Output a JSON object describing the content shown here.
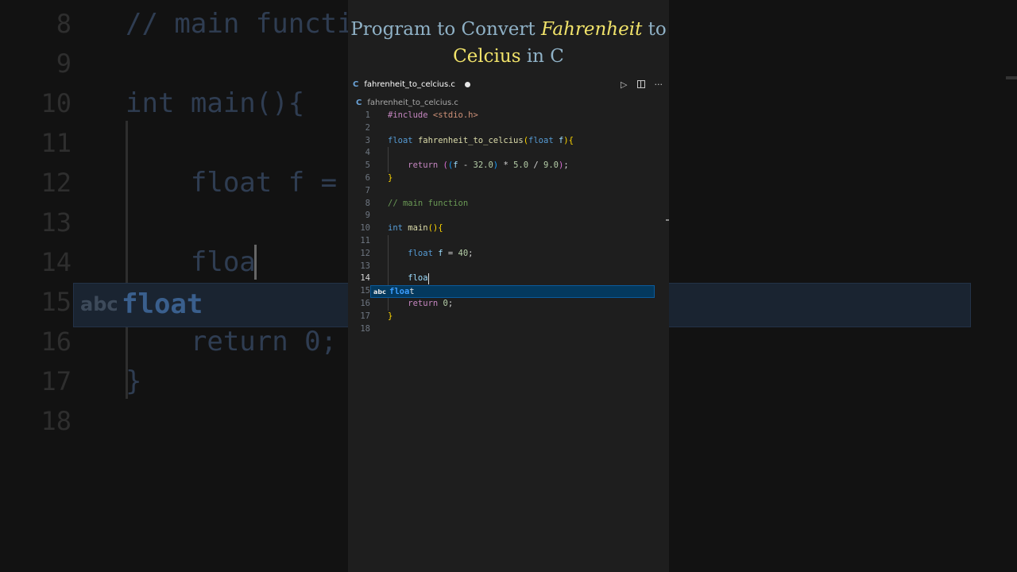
{
  "title": {
    "part1": "Program to Convert ",
    "highlight1": "Fahrenheit",
    "part2": " to",
    "highlight2": "Celcius",
    "part3": " in C"
  },
  "tab": {
    "icon": "C",
    "filename": "fahrenheit_to_celcius.c"
  },
  "breadcrumb": {
    "icon": "C",
    "filename": "fahrenheit_to_celcius.c"
  },
  "editor": {
    "active_line": 14,
    "lines": [
      {
        "n": "1",
        "segs": [
          [
            "pp",
            "#include "
          ],
          [
            "str",
            "<stdio.h>"
          ]
        ]
      },
      {
        "n": "2",
        "segs": []
      },
      {
        "n": "3",
        "segs": [
          [
            "kw",
            "float "
          ],
          [
            "fn",
            "fahrenheit_to_celcius"
          ],
          [
            "br1",
            "("
          ],
          [
            "kw",
            "float "
          ],
          [
            "id",
            "f"
          ],
          [
            "br1",
            ")"
          ],
          [
            "br1",
            "{"
          ]
        ]
      },
      {
        "n": "4",
        "segs": []
      },
      {
        "n": "5",
        "segs": [
          [
            "pp",
            "    return "
          ],
          [
            "br2",
            "("
          ],
          [
            "br3",
            "("
          ],
          [
            "id",
            "f"
          ],
          [
            "",
            " - "
          ],
          [
            "nm",
            "32.0"
          ],
          [
            "br3",
            ")"
          ],
          [
            "",
            " * "
          ],
          [
            "nm",
            "5.0"
          ],
          [
            "",
            " / "
          ],
          [
            "nm",
            "9.0"
          ],
          [
            "br2",
            ")"
          ],
          [
            "",
            ";"
          ]
        ]
      },
      {
        "n": "6",
        "segs": [
          [
            "br1",
            "}"
          ]
        ]
      },
      {
        "n": "7",
        "segs": []
      },
      {
        "n": "8",
        "segs": [
          [
            "cm",
            "// main function"
          ]
        ]
      },
      {
        "n": "9",
        "segs": []
      },
      {
        "n": "10",
        "segs": [
          [
            "kw",
            "int "
          ],
          [
            "fn",
            "main"
          ],
          [
            "br1",
            "()"
          ],
          [
            "br1",
            "{"
          ]
        ]
      },
      {
        "n": "11",
        "segs": []
      },
      {
        "n": "12",
        "segs": [
          [
            "kw",
            "    float "
          ],
          [
            "id",
            "f"
          ],
          [
            "",
            " = "
          ],
          [
            "nm",
            "40"
          ],
          [
            "",
            ";"
          ]
        ]
      },
      {
        "n": "13",
        "segs": []
      },
      {
        "n": "14",
        "segs": [
          [
            "id",
            "    floa"
          ]
        ]
      },
      {
        "n": "15",
        "segs": []
      },
      {
        "n": "16",
        "segs": [
          [
            "pp",
            "    return "
          ],
          [
            "nm",
            "0"
          ],
          [
            "",
            ";"
          ]
        ]
      },
      {
        "n": "17",
        "segs": [
          [
            "br1",
            "}"
          ]
        ]
      },
      {
        "n": "18",
        "segs": []
      }
    ]
  },
  "suggestion": {
    "kind": "abc",
    "match": "floa",
    "rest": "t"
  },
  "background": {
    "lines": [
      {
        "n": "8",
        "text": "// main functi"
      },
      {
        "n": "9",
        "text": ""
      },
      {
        "n": "10",
        "text": "int main(){"
      },
      {
        "n": "11",
        "text": ""
      },
      {
        "n": "12",
        "text": "    float f = "
      },
      {
        "n": "13",
        "text": ""
      },
      {
        "n": "14",
        "text": "    floa"
      },
      {
        "n": "15",
        "text": ""
      },
      {
        "n": "16",
        "text": "    return 0;"
      },
      {
        "n": "17",
        "text": "}"
      },
      {
        "n": "18",
        "text": ""
      }
    ],
    "suggest_kind": "abc",
    "suggest_word": "float"
  },
  "icons": [
    "run-icon",
    "split-editor-icon",
    "more-actions-icon",
    "c-file-icon",
    "unsaved-dot-icon"
  ],
  "colors": {
    "keyword": "#569cd6",
    "function": "#dcdcaa",
    "number": "#b5cea8",
    "comment": "#6a9955",
    "title_text": "#8fb1c6",
    "title_highlight": "#f1e36a",
    "suggest_bg": "#04395e"
  }
}
